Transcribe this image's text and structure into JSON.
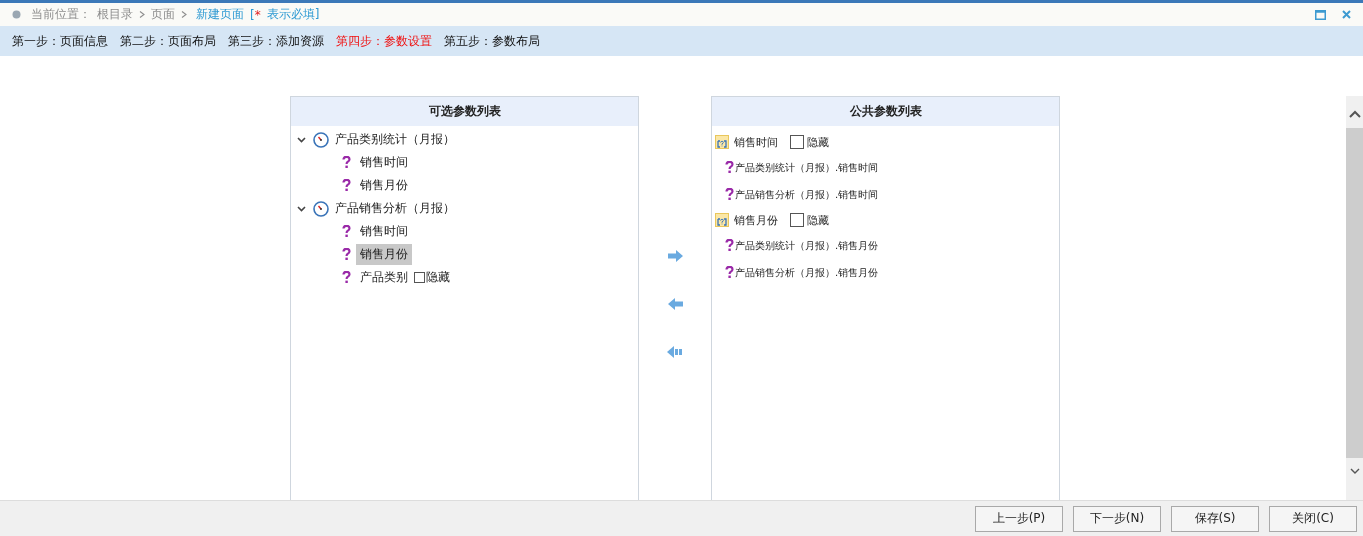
{
  "breadcrumb": {
    "label": "当前位置：",
    "items": [
      "根目录",
      "页面"
    ],
    "current": "新建页面",
    "note_open": "[",
    "required_mark": "*",
    "note": "表示必填]"
  },
  "steps": [
    {
      "label": "第一步：页面信息",
      "selected": false
    },
    {
      "label": "第二步：页面布局",
      "selected": false
    },
    {
      "label": "第三步：添加资源",
      "selected": false
    },
    {
      "label": "第四步：参数设置",
      "selected": true
    },
    {
      "label": "第五步：参数布局",
      "selected": false
    }
  ],
  "left_panel": {
    "title": "可选参数列表",
    "tree": [
      {
        "label": "产品类别统计（月报）",
        "expanded": true,
        "children": [
          {
            "label": "销售时间",
            "selected": false
          },
          {
            "label": "销售月份",
            "selected": false
          }
        ]
      },
      {
        "label": "产品销售分析（月报）",
        "expanded": true,
        "children": [
          {
            "label": "销售时间",
            "selected": false
          },
          {
            "label": "销售月份",
            "selected": true
          },
          {
            "label": "产品类别",
            "selected": false,
            "hide_label": "隐藏",
            "hidden": false
          }
        ]
      }
    ]
  },
  "right_panel": {
    "title": "公共参数列表",
    "groups": [
      {
        "label": "销售时间",
        "hide_label": "隐藏",
        "hidden": false,
        "sources": [
          "产品类别统计（月报）.销售时间",
          "产品销售分析（月报）.销售时间"
        ]
      },
      {
        "label": "销售月份",
        "hide_label": "隐藏",
        "hidden": false,
        "sources": [
          "产品类别统计（月报）.销售月份",
          "产品销售分析（月报）.销售月份"
        ]
      }
    ]
  },
  "footer_buttons": [
    "上一步(P)",
    "下一步(N)",
    "保存(S)",
    "关闭(C)"
  ]
}
